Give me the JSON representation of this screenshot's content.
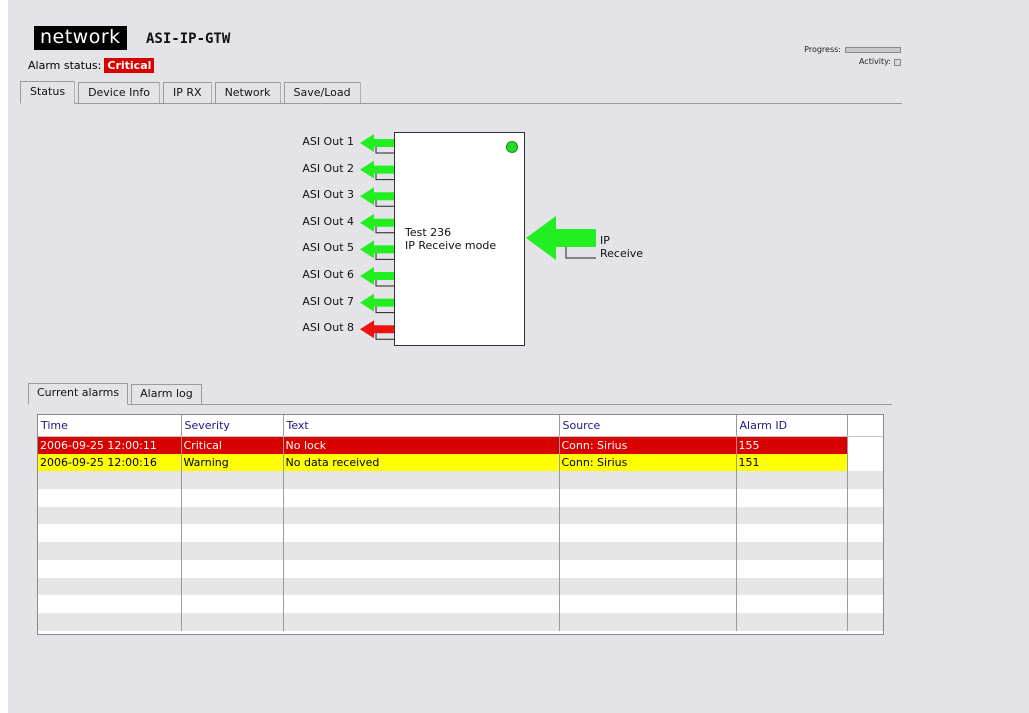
{
  "header": {
    "logo": "network",
    "product": "ASI-IP-GTW",
    "alarm_status_label": "Alarm status:",
    "alarm_status_value": "Critical",
    "progress_label": "Progress:",
    "activity_label": "Activity:"
  },
  "tabs": [
    {
      "label": "Status",
      "active": true
    },
    {
      "label": "Device Info",
      "active": false
    },
    {
      "label": "IP RX",
      "active": false
    },
    {
      "label": "Network",
      "active": false
    },
    {
      "label": "Save/Load",
      "active": false
    }
  ],
  "diagram": {
    "outputs": [
      {
        "label": "ASI Out 1",
        "status": "ok"
      },
      {
        "label": "ASI Out 2",
        "status": "ok"
      },
      {
        "label": "ASI Out 3",
        "status": "ok"
      },
      {
        "label": "ASI Out 4",
        "status": "ok"
      },
      {
        "label": "ASI Out 5",
        "status": "ok"
      },
      {
        "label": "ASI Out 6",
        "status": "ok"
      },
      {
        "label": "ASI Out 7",
        "status": "ok"
      },
      {
        "label": "ASI Out 8",
        "status": "error"
      }
    ],
    "device_name_line1": "Test 236",
    "device_name_line2": "IP Receive mode",
    "input_label": "IP Receive",
    "colors": {
      "ok": "#22ee22",
      "error": "#ee1111",
      "led": "#22dd22"
    }
  },
  "alarm_tabs": [
    {
      "label": "Current alarms",
      "active": true
    },
    {
      "label": "Alarm log",
      "active": false
    }
  ],
  "alarm_table": {
    "columns": [
      "Time",
      "Severity",
      "Text",
      "Source",
      "Alarm ID"
    ],
    "rows": [
      {
        "time": "2006-09-25 12:00:11",
        "severity": "Critical",
        "text": "No lock",
        "source": "Conn: Sirius",
        "alarm_id": "155"
      },
      {
        "time": "2006-09-25 12:00:16",
        "severity": "Warning",
        "text": "No data received",
        "source": "Conn: Sirius",
        "alarm_id": "151"
      }
    ],
    "empty_rows": 9
  }
}
